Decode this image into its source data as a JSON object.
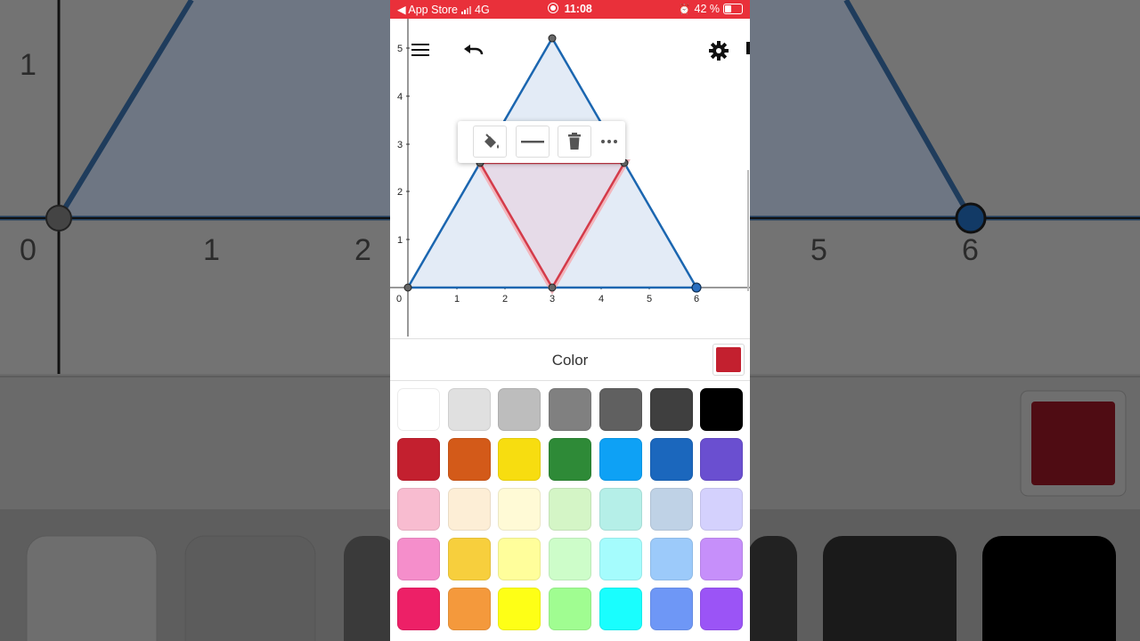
{
  "status_bar": {
    "back_label": "◀ App Store",
    "network": "4G",
    "time": "11:08",
    "battery": "42 %"
  },
  "graph": {
    "y_ticks": [
      "1",
      "2",
      "3",
      "4",
      "5"
    ],
    "x_ticks": [
      "0",
      "1",
      "2",
      "3",
      "4",
      "5",
      "6"
    ],
    "outer_triangle_color": "#1b66b0",
    "outer_fill": "#e3ebf6",
    "inner_triangle_color": "#d43b4a",
    "inner_fill": "#e6dbe8"
  },
  "toolbar": {
    "menu_icon": "menu-icon",
    "undo_icon": "undo-icon",
    "settings_icon": "gear-icon"
  },
  "style_popup": {
    "fill_icon": "paint-bucket-icon",
    "line_icon": "line-style-icon",
    "delete_icon": "trash-icon",
    "more_icon": "more-icon"
  },
  "color_panel": {
    "title": "Color",
    "selected_color": "#c3202f",
    "swatches": [
      [
        "#ffffff",
        "#e0e0e0",
        "#bdbdbd",
        "#808080",
        "#606060",
        "#3f3f3f",
        "#000000"
      ],
      [
        "#c3202f",
        "#d35a19",
        "#f7dd10",
        "#2e8a37",
        "#0ea1f5",
        "#1b67bd",
        "#6a4fd0"
      ],
      [
        "#f8bcd0",
        "#fdeed6",
        "#fffad6",
        "#d4f5c6",
        "#b5efe8",
        "#bfd2e6",
        "#d4d1fd"
      ],
      [
        "#f58ecb",
        "#f7cf3d",
        "#fffe9b",
        "#cdfdc9",
        "#a5fcfd",
        "#9ccafa",
        "#c68ffa"
      ],
      [
        "#ed2067",
        "#f4993c",
        "#feff16",
        "#a0fd91",
        "#19fefe",
        "#6e97f6",
        "#9b54f6"
      ]
    ]
  }
}
